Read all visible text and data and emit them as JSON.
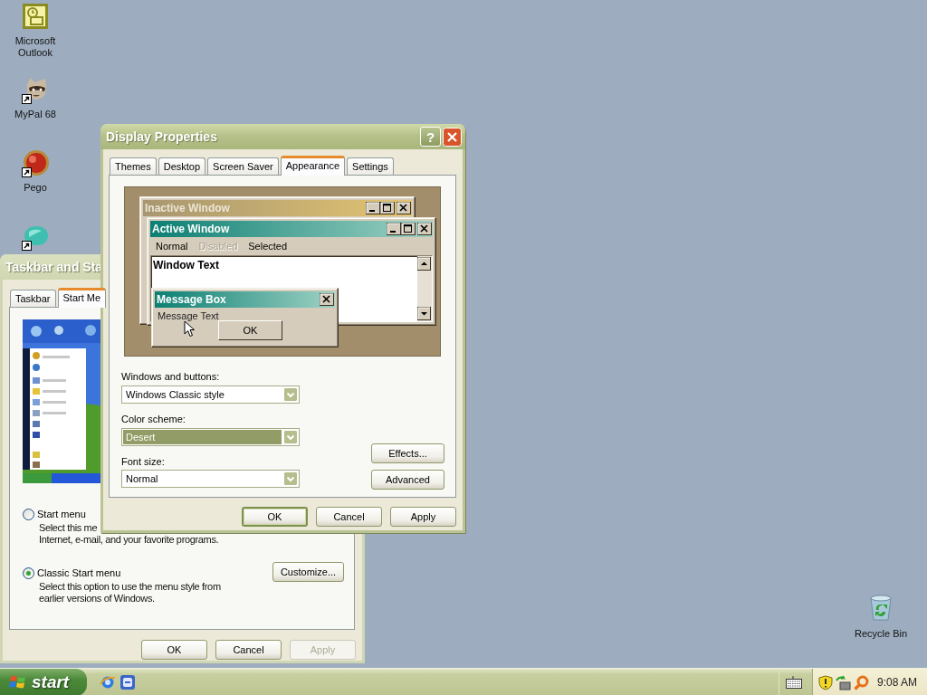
{
  "desktop": {
    "icons": [
      {
        "label": "Microsoft Outlook",
        "kind": "outlook"
      },
      {
        "label": "MyPal 68",
        "kind": "raccoon"
      },
      {
        "label": "Pego",
        "kind": "ball"
      },
      {
        "kind": "blob"
      }
    ],
    "recycle_bin": {
      "label": "Recycle Bin"
    }
  },
  "taskbar_window": {
    "title": "Taskbar and Sta",
    "tabs": [
      {
        "label": "Taskbar",
        "selected": false
      },
      {
        "label": "Start Me",
        "selected": true
      }
    ],
    "options": [
      {
        "label": "Start menu",
        "selected": false,
        "description": [
          "Select this me",
          "Internet, e-mail, and your favorite programs."
        ]
      },
      {
        "label": "Classic Start menu",
        "selected": true,
        "description": [
          "Select this option to use the menu style from",
          "earlier versions of Windows."
        ]
      }
    ],
    "customize_button": "Customize...",
    "buttons": [
      {
        "label": "OK",
        "disabled": false
      },
      {
        "label": "Cancel",
        "disabled": false
      },
      {
        "label": "Apply",
        "disabled": true
      }
    ]
  },
  "display_window": {
    "title": "Display Properties",
    "help_button": "?",
    "tabs": [
      {
        "label": "Themes",
        "selected": false
      },
      {
        "label": "Desktop",
        "selected": false
      },
      {
        "label": "Screen Saver",
        "selected": false
      },
      {
        "label": "Appearance",
        "selected": true
      },
      {
        "label": "Settings",
        "selected": false
      }
    ],
    "preview": {
      "inactive_title": "Inactive Window",
      "active_title": "Active Window",
      "menu": [
        {
          "label": "Normal",
          "disabled": false
        },
        {
          "label": "Disabled",
          "disabled": true
        },
        {
          "label": "Selected",
          "disabled": false
        }
      ],
      "window_text": "Window Text",
      "message_title": "Message Box",
      "message_text": "Message Text",
      "message_button": "OK"
    },
    "fields": [
      {
        "label": "Windows and buttons:",
        "value": "Windows Classic style",
        "highlighted": false
      },
      {
        "label": "Color scheme:",
        "value": "Desert",
        "highlighted": true
      },
      {
        "label": "Font size:",
        "value": "Normal",
        "highlighted": false
      }
    ],
    "side_buttons": [
      "Effects...",
      "Advanced"
    ],
    "buttons": [
      {
        "label": "OK",
        "default": true
      },
      {
        "label": "Cancel",
        "default": false
      },
      {
        "label": "Apply",
        "default": false
      }
    ]
  },
  "taskbar": {
    "start": "start",
    "clock": "9:08 AM"
  }
}
